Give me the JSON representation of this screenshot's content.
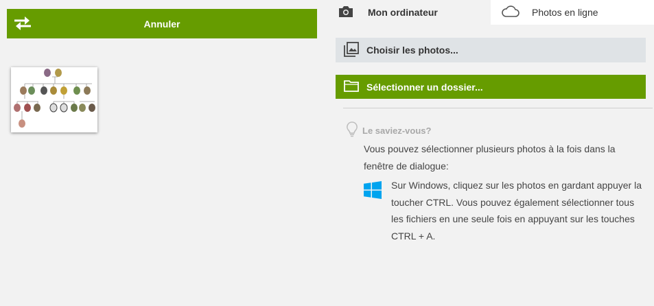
{
  "left_pane": {
    "cancel_label": "Annuler"
  },
  "tabs": {
    "computer_label": "Mon ordinateur",
    "online_label": "Photos en ligne"
  },
  "actions": {
    "choose_photos_label": "Choisir les photos...",
    "select_folder_label": "Sélectionner un dossier..."
  },
  "tip": {
    "title": "Le saviez-vous?",
    "intro": "Vous pouvez sélectionner plusieurs photos à la fois dans la fenêtre de dialogue:",
    "windows_text": "Sur Windows, cliquez sur les photos en gardant appuyer la toucher CTRL. Vous pouvez également sélectionner tous les fichiers en une seule fois en appuyant sur les touches CTRL + A."
  },
  "icons": {
    "swap": "swap-arrows-icon",
    "camera": "camera-icon",
    "cloud": "cloud-icon",
    "photos": "photo-gallery-icon",
    "folder": "folder-icon",
    "bulb": "lightbulb-icon",
    "windows": "windows-logo-icon"
  },
  "colors": {
    "accent_green": "#669c00",
    "background": "#f2f2f2",
    "secondary_button": "#dfe3e6",
    "windows_blue": "#00a4ef"
  }
}
